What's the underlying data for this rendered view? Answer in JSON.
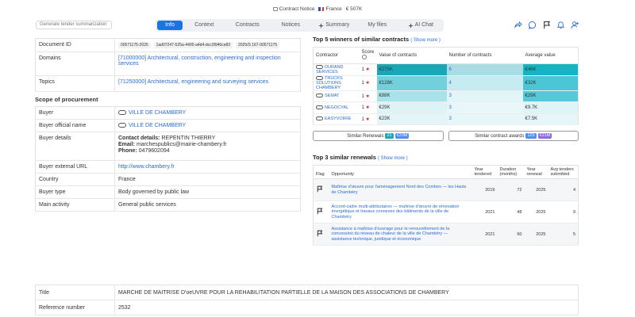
{
  "top_chips": {
    "contract_notice": "Contract Notice",
    "country": "France",
    "value": "€ 507K"
  },
  "nav": {
    "generate_button": "Generate tender summarization",
    "tabs": [
      "Info",
      "Context",
      "Contracts",
      "Notices",
      "Summary",
      "My files",
      "AI Chat"
    ]
  },
  "left": {
    "document_id": {
      "label": "Document ID",
      "ids": [
        "00571175-2025",
        "1ad07247-525a-4400-a4d4-dcc3f946ce83",
        "2025/S 167-00571175"
      ]
    },
    "domains": {
      "label": "Domains",
      "value": "[71000000] Architectural, construction, engineering and inspection services"
    },
    "topics": {
      "label": "Topics",
      "value": "[71250000] Architectural, engineering and surveying services"
    },
    "scope_title": "Scope of procurement",
    "buyer": {
      "label": "Buyer",
      "value": "VILLE DE CHAMBERY"
    },
    "buyer_official": {
      "label": "Buyer official name",
      "value": "VILLE DE CHAMBERY"
    },
    "buyer_details": {
      "label": "Buyer details",
      "contact_label": "Contact details:",
      "contact_value": "REPENTIN THIERRY",
      "email_label": "Email:",
      "email_value": "marchespublics@mairie-chambery.fr",
      "phone_label": "Phone:",
      "phone_value": "0479602094"
    },
    "buyer_url": {
      "label": "Buyer external URL",
      "value": "http://www.chambery.fr"
    },
    "country": {
      "label": "Country",
      "value": "France"
    },
    "buyer_type": {
      "label": "Buyer type",
      "value": "Body governed by public law"
    },
    "main_activity": {
      "label": "Main activity",
      "value": "General public services"
    }
  },
  "winners": {
    "title": "Top 5 winners of similar contracts",
    "more": "( Show more )",
    "headers": {
      "contractor": "Contractor",
      "score": "Score",
      "value": "Value of contracts",
      "number": "Number of contracts",
      "average": "Average value"
    },
    "rows": [
      {
        "name": "DURAND SERVICES",
        "score": "1",
        "value": "€275K",
        "number": "6",
        "average": "€46K",
        "value_color": "#1aa6b7",
        "num_color": "#a8dde6",
        "avg_color": "#16b3c4"
      },
      {
        "name": "TRUCKS SOLUTIONS CHAMBERY",
        "score": "1",
        "value": "€128K",
        "number": "4",
        "average": "€32K",
        "value_color": "#72d0dc",
        "num_color": "#c6ebf0",
        "avg_color": "#4ac6d6"
      },
      {
        "name": "SEMAT",
        "score": "1",
        "value": "€88K",
        "number": "3",
        "average": "€29K",
        "value_color": "#a9e2ea",
        "num_color": "#e2f5f8",
        "avg_color": "#55c9d8"
      },
      {
        "name": "NEGOCYAL",
        "score": "1",
        "value": "€29K",
        "number": "3",
        "average": "€9.7K",
        "value_color": "#dff3f6",
        "num_color": "#e6f6f9",
        "avg_color": "#dff4f7"
      },
      {
        "name": "EASYVOIRIE",
        "score": "1",
        "value": "€23K",
        "number": "3",
        "average": "€7.5K",
        "value_color": "#e4f5f8",
        "num_color": "#e6f6f9",
        "avg_color": "#e6f6f9"
      }
    ],
    "similar_renewals": {
      "label": "Similar Renewals",
      "count": "21",
      "amount": "€20M"
    },
    "similar_awards": {
      "label": "Similar contract awards",
      "count": "125",
      "amount": "€21M"
    }
  },
  "renewals": {
    "title": "Top 3 similar renewals",
    "more": "( Show more )",
    "headers": {
      "flag": "Flag",
      "opportunity": "Opportunity",
      "year_tendered": "Year tendered",
      "duration": "Duration (months)",
      "year_renewal": "Year renewal",
      "avg_tenders": "Avg tenders submitted"
    },
    "rows": [
      {
        "title": "Maîtrise d'œuvre pour l'aménagement Nord des Combes — les Hauts de Chambéry",
        "year": "2019",
        "duration": "72",
        "renewal": "2025",
        "avg": "4"
      },
      {
        "title": "Accord-cadre multi-attributaires — maîtrise d'œuvre de rénovation énergétique et travaux connexes des bâtiments de la ville de Chambéry",
        "year": "2021",
        "duration": "48",
        "renewal": "2025",
        "avg": "9"
      },
      {
        "title": "Assistance à maîtrise d'ouvrage pour le renouvellement de la concession du réseau de chaleur de la ville de Chambéry — assistance technique, juridique et économique",
        "year": "2021",
        "duration": "60",
        "renewal": "2025",
        "avg": "5"
      }
    ]
  },
  "bottom": {
    "title_label": "Title",
    "title_value": "MARCHE DE MAITRISE D'oeUVRE POUR LA REHABILITATION PARTIELLE DE LA MAISON DES ASSOCIATIONS DE CHAMBERY",
    "ref_label": "Reference number",
    "ref_value": "2532"
  },
  "colors": {
    "accent": "#1c73e8",
    "renewals_badge": "#1aa6b7",
    "renewals_amount": "#4f8ff0",
    "awards_badge": "#4f8ff0",
    "awards_amount": "#8a6be0"
  }
}
